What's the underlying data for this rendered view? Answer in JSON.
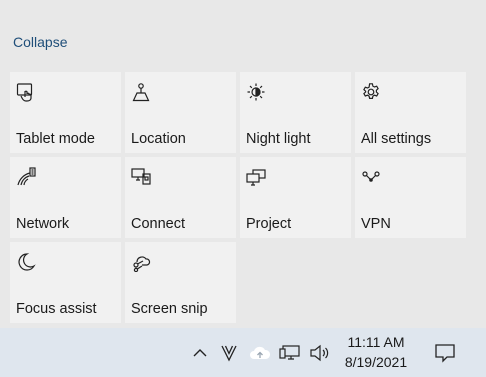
{
  "action_center": {
    "collapse_label": "Collapse",
    "tiles": [
      {
        "label": "Tablet mode",
        "icon": "tablet-mode-icon"
      },
      {
        "label": "Location",
        "icon": "location-icon"
      },
      {
        "label": "Night light",
        "icon": "night-light-icon"
      },
      {
        "label": "All settings",
        "icon": "gear-icon"
      },
      {
        "label": "Network",
        "icon": "network-icon"
      },
      {
        "label": "Connect",
        "icon": "connect-icon"
      },
      {
        "label": "Project",
        "icon": "project-icon"
      },
      {
        "label": "VPN",
        "icon": "vpn-icon"
      },
      {
        "label": "Focus assist",
        "icon": "moon-icon"
      },
      {
        "label": "Screen snip",
        "icon": "screen-snip-icon"
      }
    ]
  },
  "taskbar": {
    "tray_icons": [
      "chevron-up-icon",
      "v-app-icon",
      "cloud-upload-icon",
      "network-wired-icon",
      "volume-icon"
    ],
    "clock": {
      "time": "11:11 AM",
      "date": "8/19/2021"
    },
    "notification_icon": "notification-icon"
  }
}
